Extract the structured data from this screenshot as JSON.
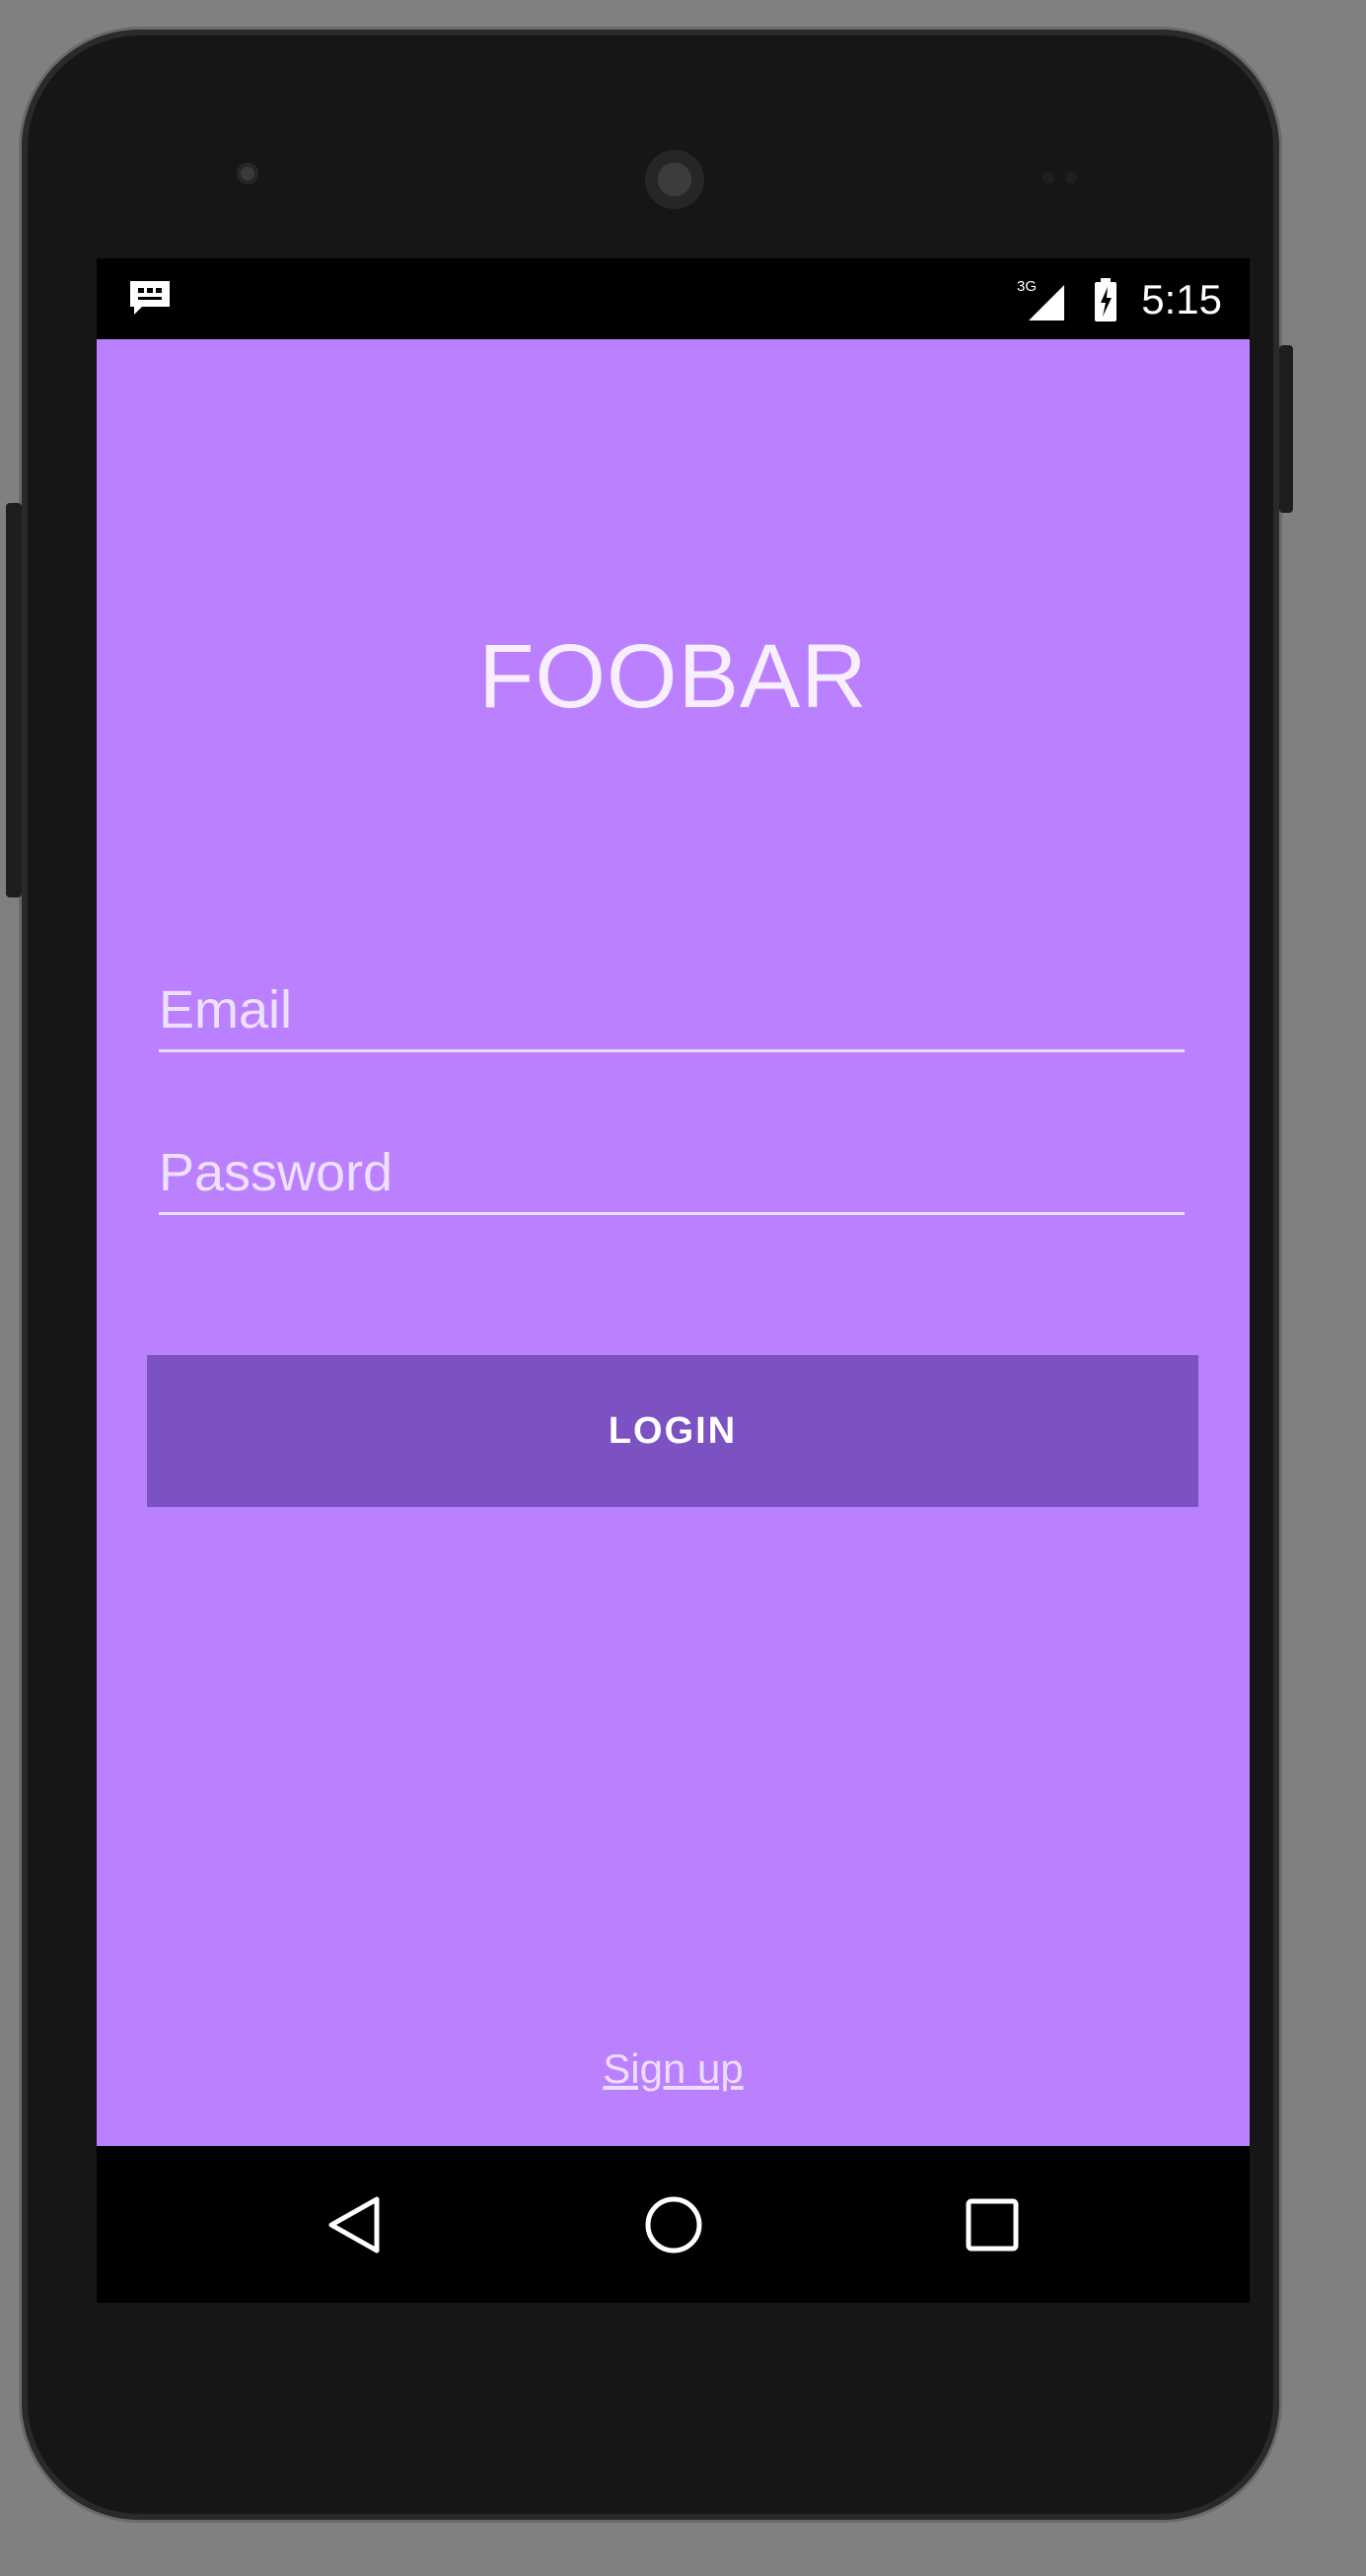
{
  "status_bar": {
    "time": "5:15",
    "network_label": "3G",
    "icons": [
      "message-notification-icon",
      "signal-3g-icon",
      "battery-charging-icon"
    ]
  },
  "app": {
    "title": "FOOBAR",
    "email_placeholder": "Email",
    "email_value": "",
    "password_placeholder": "Password",
    "password_value": "",
    "login_label": "LOGIN",
    "signup_label": "Sign up"
  },
  "nav_bar": {
    "buttons": [
      "back-icon",
      "home-icon",
      "recents-icon"
    ]
  },
  "colors": {
    "background": "#bb80fe",
    "button": "#7c51c1",
    "bars": "#000000"
  }
}
